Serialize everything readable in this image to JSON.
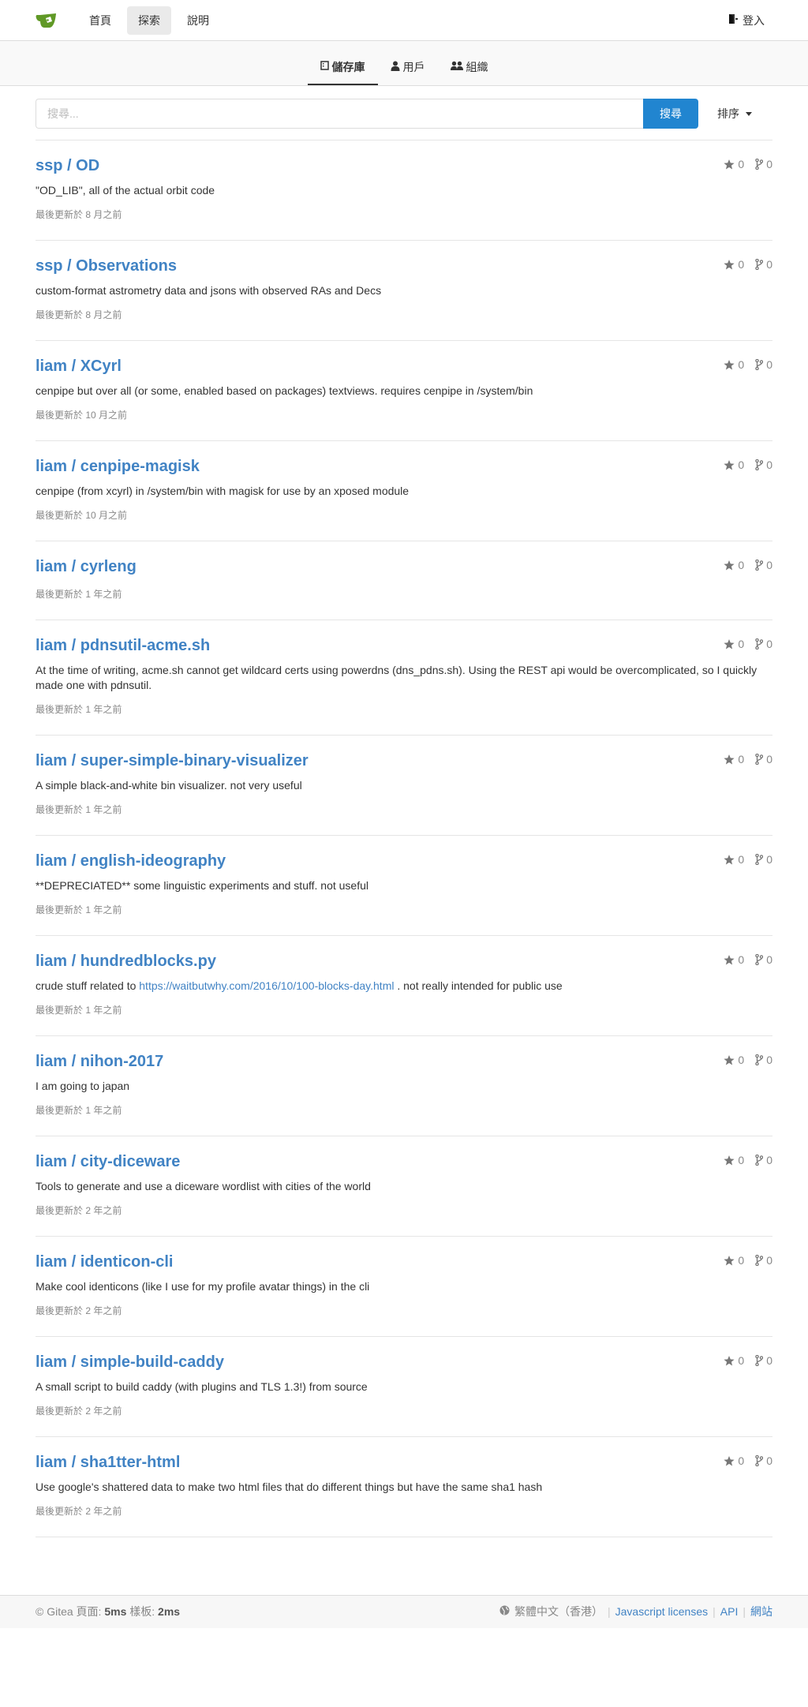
{
  "nav": {
    "items": [
      {
        "label": "首頁"
      },
      {
        "label": "探索"
      },
      {
        "label": "說明"
      }
    ],
    "login_label": "登入"
  },
  "tabs": [
    {
      "label": "儲存庫",
      "icon": "repo-icon"
    },
    {
      "label": "用戶",
      "icon": "person-icon"
    },
    {
      "label": "組織",
      "icon": "organization-icon"
    }
  ],
  "search": {
    "placeholder": "搜尋...",
    "value": "",
    "button_label": "搜尋",
    "sort_label": "排序"
  },
  "repos": [
    {
      "owner": "ssp",
      "name": "OD",
      "title": "ssp / OD",
      "stars": "0",
      "forks": "0",
      "description": "\"OD_LIB\", all of the actual orbit code",
      "updated": "最後更新於 8 月之前"
    },
    {
      "owner": "ssp",
      "name": "Observations",
      "title": "ssp / Observations",
      "stars": "0",
      "forks": "0",
      "description": "custom-format astrometry data and jsons with observed RAs and Decs",
      "updated": "最後更新於 8 月之前"
    },
    {
      "owner": "liam",
      "name": "XCyrl",
      "title": "liam / XCyrl",
      "stars": "0",
      "forks": "0",
      "description": "cenpipe but over all (or some, enabled based on packages) textviews. requires cenpipe in /system/bin",
      "updated": "最後更新於 10 月之前"
    },
    {
      "owner": "liam",
      "name": "cenpipe-magisk",
      "title": "liam / cenpipe-magisk",
      "stars": "0",
      "forks": "0",
      "description": "cenpipe (from xcyrl) in /system/bin with magisk for use by an xposed module",
      "updated": "最後更新於 10 月之前"
    },
    {
      "owner": "liam",
      "name": "cyrleng",
      "title": "liam / cyrleng",
      "stars": "0",
      "forks": "0",
      "description": "",
      "updated": "最後更新於 1 年之前"
    },
    {
      "owner": "liam",
      "name": "pdnsutil-acme.sh",
      "title": "liam / pdnsutil-acme.sh",
      "stars": "0",
      "forks": "0",
      "description": "At the time of writing, acme.sh cannot get wildcard certs using powerdns (dns_pdns.sh). Using the REST api would be overcomplicated, so I quickly made one with pdnsutil.",
      "updated": "最後更新於 1 年之前"
    },
    {
      "owner": "liam",
      "name": "super-simple-binary-visualizer",
      "title": "liam / super-simple-binary-visualizer",
      "stars": "0",
      "forks": "0",
      "description": "A simple black-and-white bin visualizer. not very useful",
      "updated": "最後更新於 1 年之前"
    },
    {
      "owner": "liam",
      "name": "english-ideography",
      "title": "liam / english-ideography",
      "stars": "0",
      "forks": "0",
      "description": "**DEPRECIATED** some linguistic experiments and stuff. not useful",
      "updated": "最後更新於 1 年之前"
    },
    {
      "owner": "liam",
      "name": "hundredblocks.py",
      "title": "liam / hundredblocks.py",
      "stars": "0",
      "forks": "0",
      "description": "crude stuff related to ",
      "link": "https://waitbutwhy.com/2016/10/100-blocks-day.html",
      "description_after": " . not really intended for public use",
      "updated": "最後更新於 1 年之前"
    },
    {
      "owner": "liam",
      "name": "nihon-2017",
      "title": "liam / nihon-2017",
      "stars": "0",
      "forks": "0",
      "description": "I am going to japan",
      "updated": "最後更新於 1 年之前"
    },
    {
      "owner": "liam",
      "name": "city-diceware",
      "title": "liam / city-diceware",
      "stars": "0",
      "forks": "0",
      "description": "Tools to generate and use a diceware wordlist with cities of the world",
      "updated": "最後更新於 2 年之前"
    },
    {
      "owner": "liam",
      "name": "identicon-cli",
      "title": "liam / identicon-cli",
      "stars": "0",
      "forks": "0",
      "description": "Make cool identicons (like I use for my profile avatar things) in the cli",
      "updated": "最後更新於 2 年之前"
    },
    {
      "owner": "liam",
      "name": "simple-build-caddy",
      "title": "liam / simple-build-caddy",
      "stars": "0",
      "forks": "0",
      "description": "A small script to build caddy (with plugins and TLS 1.3!) from source",
      "updated": "最後更新於 2 年之前"
    },
    {
      "owner": "liam",
      "name": "sha1tter-html",
      "title": "liam / sha1tter-html",
      "stars": "0",
      "forks": "0",
      "description": "Use google's shattered data to make two html files that do different things but have the same sha1 hash",
      "updated": "最後更新於 2 年之前"
    }
  ],
  "footer": {
    "powered": "© Gitea 頁面:",
    "page_time": "5ms",
    "template_label": "樣板:",
    "template_time": "2ms",
    "language": "繁體中文（香港）",
    "links": [
      {
        "label": "Javascript licenses"
      },
      {
        "label": "API"
      },
      {
        "label": "網站"
      }
    ]
  },
  "colors": {
    "accent": "#2185d0",
    "link": "#4183c4",
    "logo_green": "#609926"
  }
}
